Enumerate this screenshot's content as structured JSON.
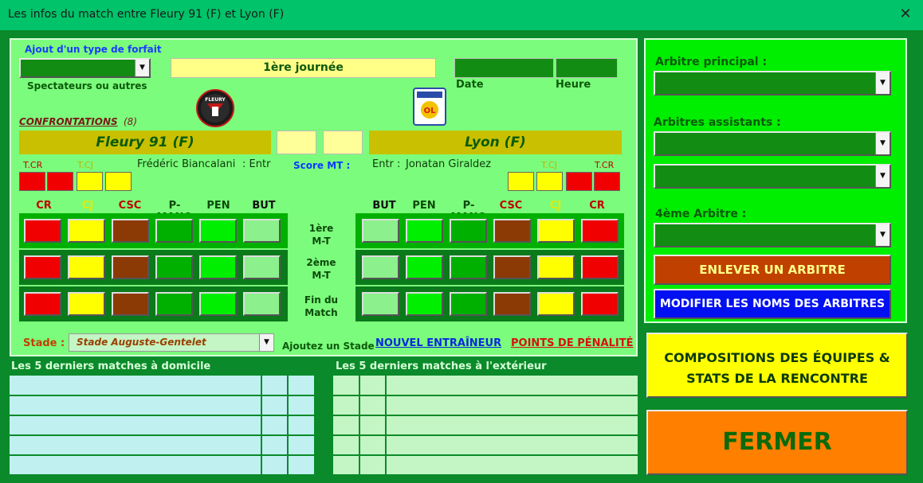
{
  "window": {
    "title": "Les infos du match entre Fleury 91 (F) et Lyon (F)"
  },
  "forfait": {
    "link": "Ajout d'un type de forfait",
    "spectators_label": "Spectateurs ou autres"
  },
  "journee": "1ère journée",
  "date_label": "Date",
  "time_label": "Heure",
  "confrontations": {
    "label": "CONFRONTATIONS",
    "count": "(8)"
  },
  "home": {
    "name": "Fleury 91 (F)",
    "coach": "Frédéric Biancalani",
    "coach_suffix": ": Entr",
    "logo_text": "FLEURY"
  },
  "away": {
    "name": "Lyon (F)",
    "coach_prefix": "Entr :",
    "coach": "Jonatan Giraldez",
    "logo_text": "OL"
  },
  "score_mt_label": "Score MT :",
  "card_labels": {
    "tcr": "T.CR",
    "tcj": "T.CJ"
  },
  "columns_home": [
    "CR",
    "CJ",
    "CSC",
    "P-MANQ",
    "PEN",
    "BUT"
  ],
  "columns_away": [
    "BUT",
    "PEN",
    "P-MANQ",
    "CSC",
    "CJ",
    "CR"
  ],
  "rows": [
    {
      "line1": "1ère",
      "line2": "M-T"
    },
    {
      "line1": "2ème",
      "line2": "M-T"
    },
    {
      "line1": "Fin du",
      "line2": "Match"
    }
  ],
  "stade": {
    "label": "Stade :",
    "value": "Stade Auguste-Gentelet",
    "add_label": "Ajoutez un Stade"
  },
  "links": {
    "new_coach": "NOUVEL ENTRAÎNEUR",
    "penalty_points": "POINTS DE PÉNALITÉ"
  },
  "history": {
    "home_title": "Les 5 derniers matches à domicile",
    "away_title": "Les 5 derniers matches à l'extérieur"
  },
  "referees": {
    "main_label": "Arbitre principal :",
    "assistants_label": "Arbitres assistants :",
    "fourth_label": "4ème Arbitre :",
    "remove_button": "ENLEVER UN ARBITRE",
    "modify_button": "MODIFIER LES NOMS DES ARBITRES"
  },
  "buttons": {
    "compositions_line1": "COMPOSITIONS DES ÉQUIPES &",
    "compositions_line2": "STATS DE LA RENCONTRE",
    "close": "FERMER"
  },
  "colors": {
    "accent_green": "#00ee00",
    "panel_green": "#7cfc7c",
    "window_green": "#0a8a2a",
    "title_green": "#00c36a",
    "team_bar": "#c8c000"
  }
}
